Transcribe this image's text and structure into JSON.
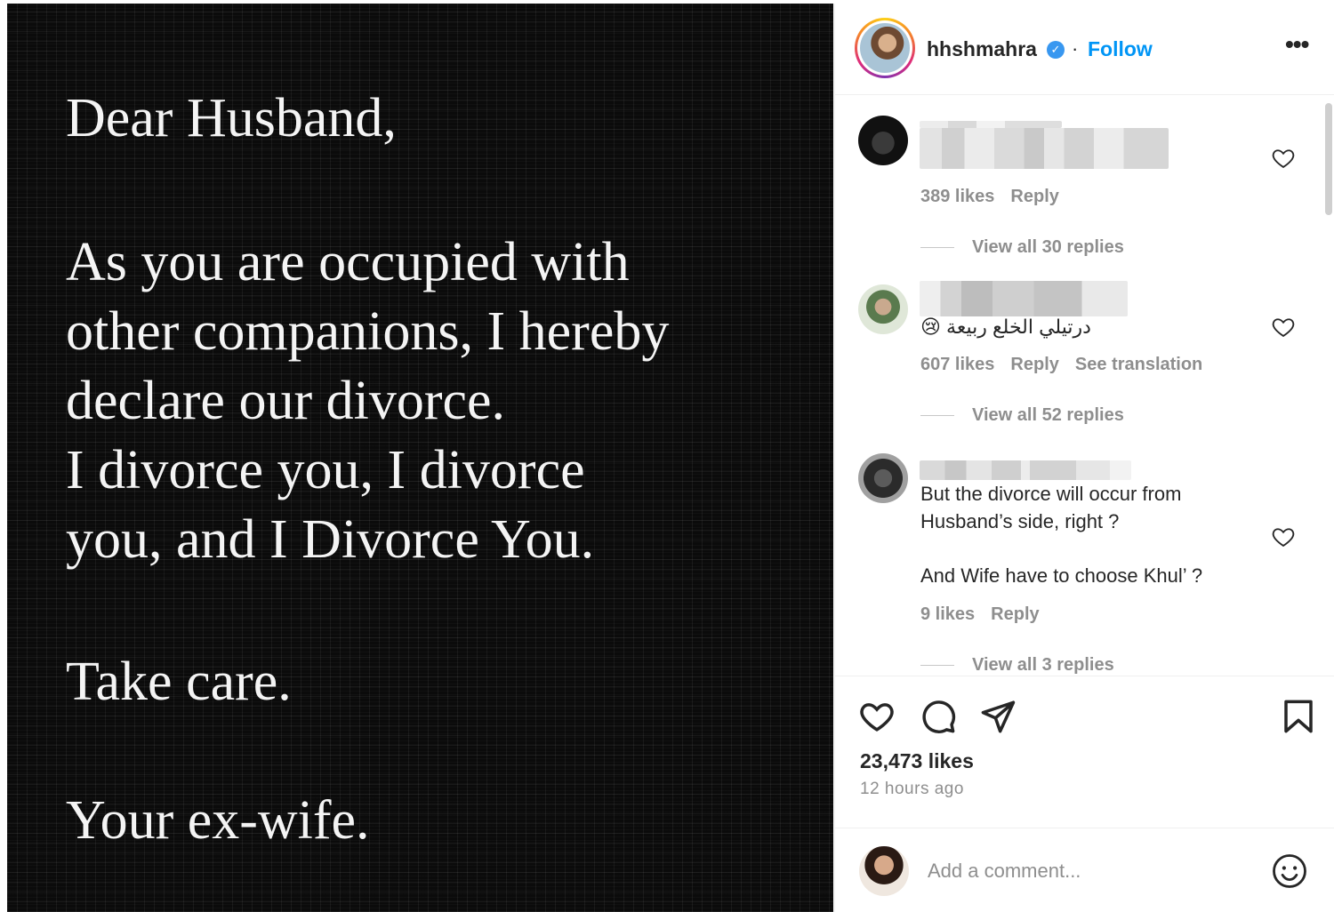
{
  "post_image": {
    "greeting": "Dear Husband,",
    "body_lines": [
      "As you are occupied with",
      "other companions, I hereby",
      "declare our divorce.",
      "I divorce you, I divorce",
      "you, and I Divorce You."
    ],
    "closing": "Take care.",
    "signoff": "Your ex-wife."
  },
  "header": {
    "username": "hhshmahra",
    "verified_icon": "verified-badge-icon",
    "separator": "·",
    "follow_label": "Follow",
    "more_icon": "more-options-icon",
    "more_glyph": "•••"
  },
  "comments": [
    {
      "likes": "389 likes",
      "reply": "Reply",
      "view_replies": "View all 30 replies"
    },
    {
      "text": "😢 درتيلي الخلع ربيعة",
      "likes": "607 likes",
      "reply": "Reply",
      "translate": "See translation",
      "view_replies": "View all 52 replies"
    },
    {
      "text_line1": "But the divorce will occur from",
      "text_line2": "Husband’s side, right ?",
      "text_line3": "And Wife have to choose Khul’ ?",
      "likes": "9 likes",
      "reply": "Reply",
      "view_replies": "View all 3 replies"
    }
  ],
  "actions": {
    "icons": [
      "heart-icon",
      "comment-icon",
      "share-icon",
      "bookmark-icon"
    ],
    "likes_count": "23,473 likes",
    "time_ago": "12 hours ago"
  },
  "comment_box": {
    "placeholder": "Add a comment...",
    "emoji_icon": "emoji-icon"
  },
  "colors": {
    "accent": "#0095f6",
    "muted": "#8e8e8e",
    "text": "#262626",
    "post_background": "#0b0b0b"
  }
}
